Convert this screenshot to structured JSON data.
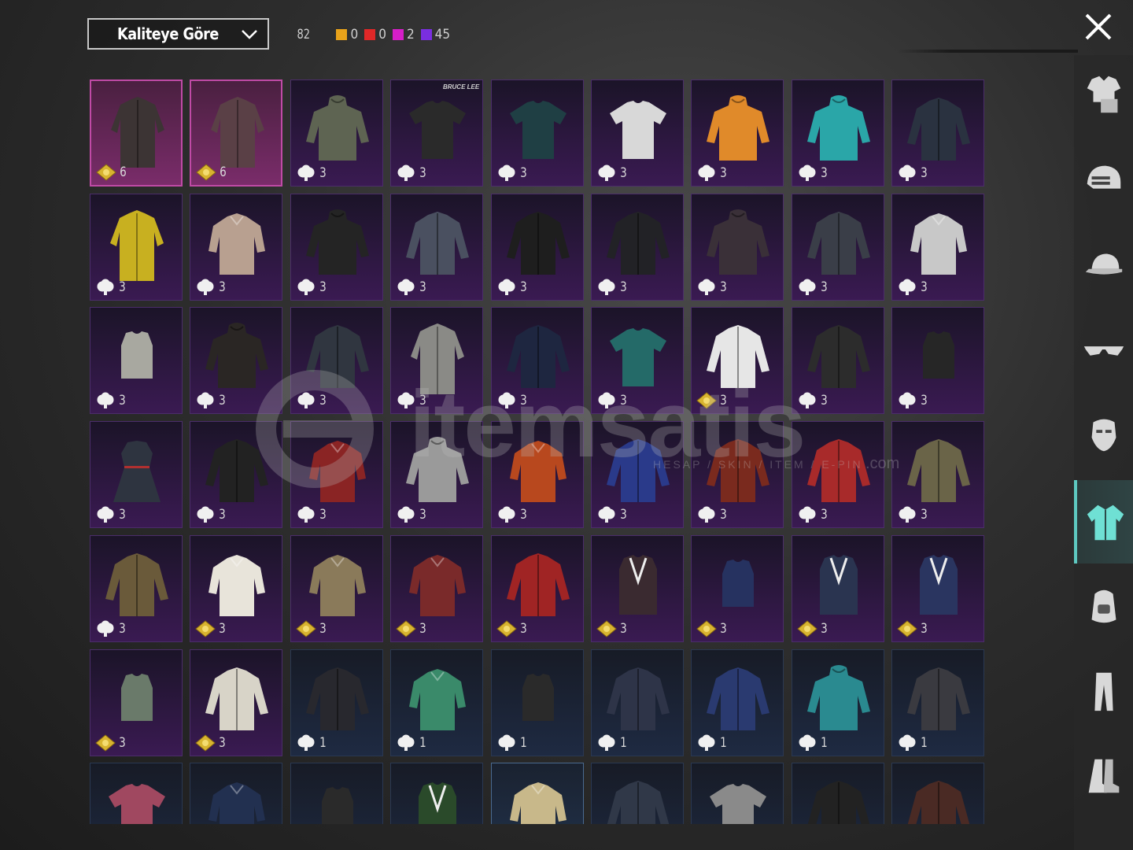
{
  "toolbar": {
    "sort_label": "Kaliteye Göre",
    "total_count": "82",
    "quality_counts": [
      {
        "color": "#e8a21a",
        "count": "0",
        "name": "legendary"
      },
      {
        "color": "#e02828",
        "count": "0",
        "name": "mythic"
      },
      {
        "color": "#d61ec8",
        "count": "2",
        "name": "epic"
      },
      {
        "color": "#7a2ee0",
        "count": "45",
        "name": "rare"
      }
    ]
  },
  "grid": {
    "rows": [
      [
        {
          "quality": "pink",
          "cur": "gold",
          "count": "6",
          "color": "#3c3434",
          "type": "coat"
        },
        {
          "quality": "pink",
          "cur": "gold",
          "count": "6",
          "color": "#5a4046",
          "type": "coat"
        },
        {
          "quality": "purple",
          "cur": "white",
          "count": "3",
          "color": "#5e6452",
          "type": "hoodie"
        },
        {
          "quality": "purple",
          "cur": "white",
          "count": "3",
          "color": "#2a2a2a",
          "type": "tshirt",
          "brand": "BRUCE LEE"
        },
        {
          "quality": "purple",
          "cur": "white",
          "count": "3",
          "color": "#1f3f44",
          "type": "tshirt"
        },
        {
          "quality": "purple",
          "cur": "white",
          "count": "3",
          "color": "#d8d8d8",
          "type": "tshirt"
        },
        {
          "quality": "purple",
          "cur": "white",
          "count": "3",
          "color": "#e08a2a",
          "type": "hoodie"
        },
        {
          "quality": "purple",
          "cur": "white",
          "count": "3",
          "color": "#2aa6a8",
          "type": "hoodie"
        },
        {
          "quality": "purple",
          "cur": "white",
          "count": "3",
          "color": "#2a3240",
          "type": "jacket"
        }
      ],
      [
        {
          "quality": "purple",
          "cur": "white",
          "count": "3",
          "color": "#c8b020",
          "type": "coat"
        },
        {
          "quality": "purple",
          "cur": "white",
          "count": "3",
          "color": "#b8a090",
          "type": "shirt"
        },
        {
          "quality": "purple",
          "cur": "white",
          "count": "3",
          "color": "#242424",
          "type": "hoodie"
        },
        {
          "quality": "purple",
          "cur": "white",
          "count": "3",
          "color": "#4a5060",
          "type": "jacket"
        },
        {
          "quality": "purple",
          "cur": "white",
          "count": "3",
          "color": "#1e1e1e",
          "type": "jacket"
        },
        {
          "quality": "purple",
          "cur": "white",
          "count": "3",
          "color": "#222226",
          "type": "jacket"
        },
        {
          "quality": "purple",
          "cur": "white",
          "count": "3",
          "color": "#3a3038",
          "type": "hoodie"
        },
        {
          "quality": "purple",
          "cur": "white",
          "count": "3",
          "color": "#3a3e48",
          "type": "jacket"
        },
        {
          "quality": "purple",
          "cur": "white",
          "count": "3",
          "color": "#c8c8c8",
          "type": "shirt"
        }
      ],
      [
        {
          "quality": "purple",
          "cur": "white",
          "count": "3",
          "color": "#a8a8a0",
          "type": "top"
        },
        {
          "quality": "purple",
          "cur": "white",
          "count": "3",
          "color": "#2a2624",
          "type": "hoodie"
        },
        {
          "quality": "purple",
          "cur": "white",
          "count": "3",
          "color": "#303640",
          "type": "jacket"
        },
        {
          "quality": "purple",
          "cur": "white",
          "count": "3",
          "color": "#8a8a86",
          "type": "coat"
        },
        {
          "quality": "purple",
          "cur": "white",
          "count": "3",
          "color": "#1e2640",
          "type": "jacket"
        },
        {
          "quality": "purple",
          "cur": "white",
          "count": "3",
          "color": "#246a68",
          "type": "tshirt"
        },
        {
          "quality": "purple",
          "cur": "gold",
          "count": "3",
          "color": "#e6e6e6",
          "type": "jacket"
        },
        {
          "quality": "purple",
          "cur": "white",
          "count": "3",
          "color": "#2c2c2c",
          "type": "jacket"
        },
        {
          "quality": "purple",
          "cur": "white",
          "count": "3",
          "color": "#262626",
          "type": "top"
        }
      ],
      [
        {
          "quality": "purple",
          "cur": "white",
          "count": "3",
          "color": "#2e3440",
          "type": "dress"
        },
        {
          "quality": "purple",
          "cur": "white",
          "count": "3",
          "color": "#222222",
          "type": "jacket"
        },
        {
          "quality": "purple",
          "cur": "white",
          "count": "3",
          "color": "#8a2424",
          "type": "shirt"
        },
        {
          "quality": "purple",
          "cur": "white",
          "count": "3",
          "color": "#9a9a9a",
          "type": "hoodie"
        },
        {
          "quality": "purple",
          "cur": "white",
          "count": "3",
          "color": "#b8481e",
          "type": "shirt"
        },
        {
          "quality": "purple",
          "cur": "white",
          "count": "3",
          "color": "#2a3a8a",
          "type": "jacket"
        },
        {
          "quality": "purple",
          "cur": "white",
          "count": "3",
          "color": "#7a2a1e",
          "type": "jacket"
        },
        {
          "quality": "purple",
          "cur": "white",
          "count": "3",
          "color": "#a82a2a",
          "type": "jacket"
        },
        {
          "quality": "purple",
          "cur": "white",
          "count": "3",
          "color": "#6a6448",
          "type": "jacket"
        }
      ],
      [
        {
          "quality": "purple",
          "cur": "white",
          "count": "3",
          "color": "#6a5a3a",
          "type": "jacket"
        },
        {
          "quality": "purple",
          "cur": "gold",
          "count": "3",
          "color": "#e8e4da",
          "type": "shirt"
        },
        {
          "quality": "purple",
          "cur": "gold",
          "count": "3",
          "color": "#8a7a5a",
          "type": "shirt"
        },
        {
          "quality": "purple",
          "cur": "gold",
          "count": "3",
          "color": "#7a2a2a",
          "type": "shirt"
        },
        {
          "quality": "purple",
          "cur": "gold",
          "count": "3",
          "color": "#a02424",
          "type": "jacket"
        },
        {
          "quality": "purple",
          "cur": "gold",
          "count": "3",
          "color": "#3a2a30",
          "type": "vest"
        },
        {
          "quality": "purple",
          "cur": "gold",
          "count": "3",
          "color": "#263260",
          "type": "top"
        },
        {
          "quality": "purple",
          "cur": "gold",
          "count": "3",
          "color": "#2a3450",
          "type": "vest"
        },
        {
          "quality": "purple",
          "cur": "gold",
          "count": "3",
          "color": "#2a3560",
          "type": "vest"
        }
      ],
      [
        {
          "quality": "purple",
          "cur": "gold",
          "count": "3",
          "color": "#6a7a6a",
          "type": "top"
        },
        {
          "quality": "purple",
          "cur": "gold",
          "count": "3",
          "color": "#d8d4c8",
          "type": "jacket"
        },
        {
          "quality": "blue",
          "cur": "white",
          "count": "1",
          "color": "#28282e",
          "type": "jacket"
        },
        {
          "quality": "blue",
          "cur": "white",
          "count": "1",
          "color": "#3a8a6a",
          "type": "shirt"
        },
        {
          "quality": "blue",
          "cur": "white",
          "count": "1",
          "color": "#2a2a2a",
          "type": "top"
        },
        {
          "quality": "blue",
          "cur": "white",
          "count": "1",
          "color": "#2e3448",
          "type": "jacket"
        },
        {
          "quality": "blue",
          "cur": "white",
          "count": "1",
          "color": "#2a3a70",
          "type": "jacket"
        },
        {
          "quality": "blue",
          "cur": "white",
          "count": "1",
          "color": "#2a8a90",
          "type": "hoodie"
        },
        {
          "quality": "blue",
          "cur": "white",
          "count": "1",
          "color": "#3a3a40",
          "type": "jacket"
        }
      ],
      [
        {
          "quality": "blue",
          "color": "#a04860",
          "type": "tshirt"
        },
        {
          "quality": "blue",
          "color": "#223050",
          "type": "shirt"
        },
        {
          "quality": "blue",
          "color": "#2a2a2a",
          "type": "top"
        },
        {
          "quality": "blue",
          "color": "#2a4a2a",
          "type": "vest"
        },
        {
          "quality": "blue-hl",
          "color": "#c8b88a",
          "type": "shirt"
        },
        {
          "quality": "blue",
          "color": "#303848",
          "type": "jacket"
        },
        {
          "quality": "blue",
          "color": "#8a8a8a",
          "type": "tshirt"
        },
        {
          "quality": "blue",
          "color": "#222222",
          "type": "jacket"
        },
        {
          "quality": "blue",
          "color": "#4a2a24",
          "type": "jacket"
        }
      ]
    ]
  },
  "watermark": {
    "brand": "itemsatis",
    "sub": "HESAP / SKIN / ITEM / E-PIN",
    "suffix": ".com"
  },
  "sidebar": {
    "categories": [
      {
        "name": "outfit"
      },
      {
        "name": "head"
      },
      {
        "name": "hat"
      },
      {
        "name": "eyewear"
      },
      {
        "name": "mask"
      },
      {
        "name": "top",
        "active": true
      },
      {
        "name": "backpack"
      },
      {
        "name": "pants"
      },
      {
        "name": "shoes"
      }
    ]
  }
}
